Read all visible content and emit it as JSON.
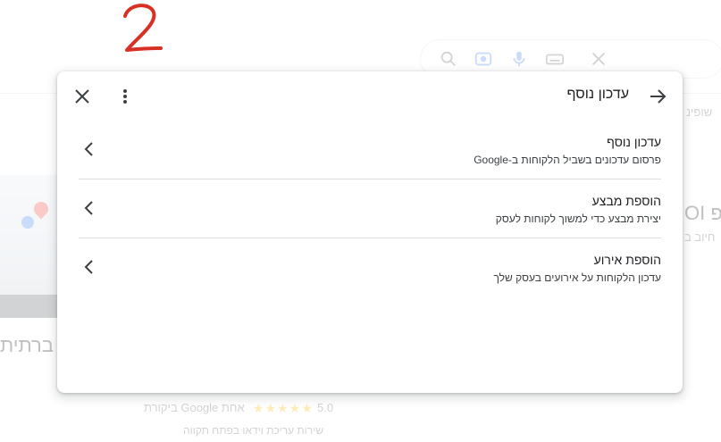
{
  "annotation": {
    "step_number": "2",
    "color": "#d93025"
  },
  "dialog": {
    "title": "עדכון נוסף",
    "icons": {
      "back": "arrow-right-icon",
      "more": "more-vert-icon",
      "close": "close-icon"
    },
    "options": [
      {
        "title": "עדכון נוסף",
        "description": "פרסום עדכונים בשביל הלקוחות ב-Google"
      },
      {
        "title": "הוספת מבצע",
        "description": "יצירת מבצע כדי למשוך לקוחות לעסק"
      },
      {
        "title": "הוספת אירוע",
        "description": "עדכון הלקוחות על אירועים בעסק שלך"
      }
    ]
  },
  "background": {
    "rating_value": "5.0",
    "rating_text": "ביקורת Google אחת",
    "sub_text": "שירות עריכת וידאו בפתח תקווה",
    "heading_fragment": "ברתית",
    "right_heading_fragment": "OI הפ",
    "right_sub_fragment": "חיוב ב",
    "top_right_fragment": "שופינ"
  }
}
